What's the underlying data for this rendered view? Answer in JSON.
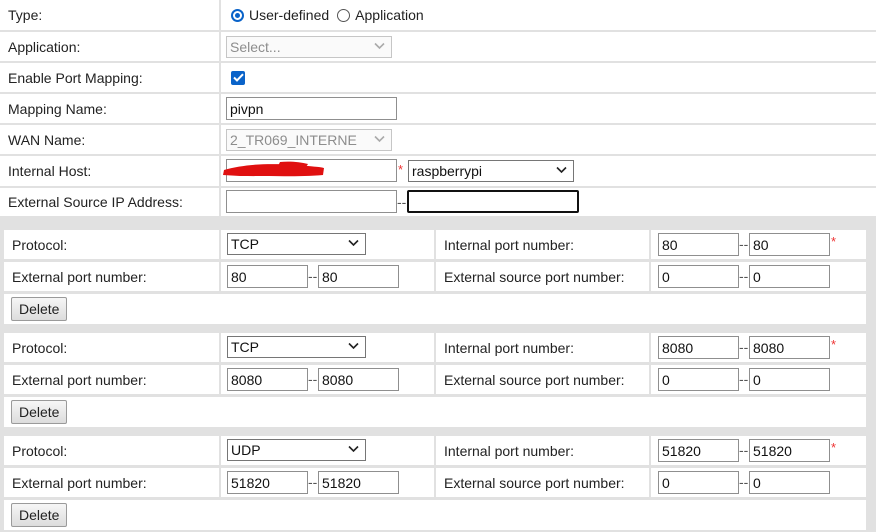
{
  "main": {
    "type_label": "Type:",
    "type_options": [
      "User-defined",
      "Application"
    ],
    "application_label": "Application:",
    "application_placeholder": "Select...",
    "enable_label": "Enable Port Mapping:",
    "mapping_name_label": "Mapping Name:",
    "mapping_name_value": "pivpn",
    "wan_label": "WAN Name:",
    "wan_value": "2_TR069_INTERNE",
    "internal_host_label": "Internal Host:",
    "internal_host_device": "raspberrypi",
    "ext_src_ip_label": "External Source IP Address:"
  },
  "labels": {
    "protocol": "Protocol:",
    "internal_port": "Internal port number:",
    "external_port": "External port number:",
    "external_source_port": "External source port number:",
    "delete": "Delete",
    "required": "*",
    "range_sep": "--"
  },
  "rules": [
    {
      "protocol": "TCP",
      "internal_from": "80",
      "internal_to": "80",
      "external_from": "80",
      "external_to": "80",
      "src_from": "0",
      "src_to": "0"
    },
    {
      "protocol": "TCP",
      "internal_from": "8080",
      "internal_to": "8080",
      "external_from": "8080",
      "external_to": "8080",
      "src_from": "0",
      "src_to": "0"
    },
    {
      "protocol": "UDP",
      "internal_from": "51820",
      "internal_to": "51820",
      "external_from": "51820",
      "external_to": "51820",
      "src_from": "0",
      "src_to": "0"
    }
  ],
  "colors": {
    "accent": "#0a63c9",
    "required": "#e33333",
    "redaction": "#e01010"
  }
}
